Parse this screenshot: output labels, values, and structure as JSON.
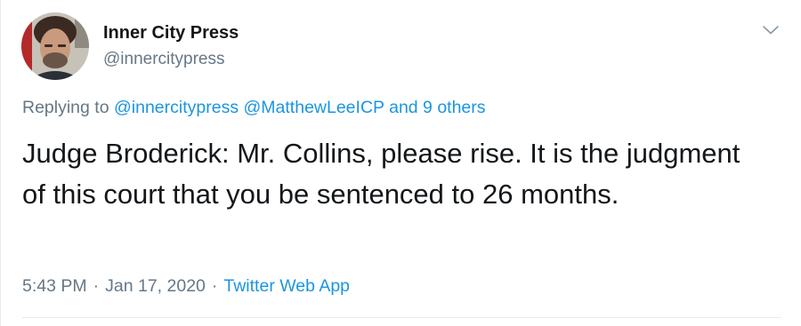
{
  "author": {
    "display_name": "Inner City Press",
    "handle": "@innercitypress"
  },
  "reply_context": {
    "prefix": "Replying to",
    "mentions": [
      "@innercitypress",
      "@MatthewLeeICP"
    ],
    "others": "and 9 others"
  },
  "tweet": {
    "text": "Judge Broderick: Mr. Collins, please rise. It is the judgment of this court that you be sentenced to 26 months."
  },
  "meta": {
    "time": "5:43 PM",
    "separator": "·",
    "date": "Jan 17, 2020",
    "source": "Twitter Web App"
  },
  "icons": {
    "menu": "chevron-down-icon",
    "avatar": "avatar-photo"
  },
  "colors": {
    "text_primary": "#14171a",
    "text_secondary": "#657786",
    "link": "#1b95e0",
    "border": "#e6ecf0"
  }
}
